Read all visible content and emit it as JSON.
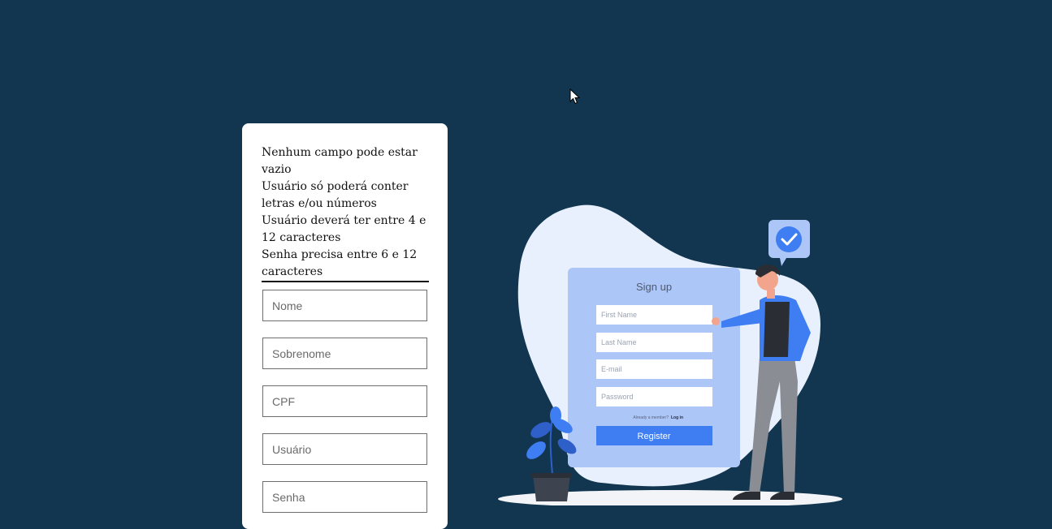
{
  "rules": [
    "Nenhum campo pode estar vazio",
    "Usuário só poderá conter letras e/ou números",
    "Usuário deverá ter entre 4 e 12 caracteres",
    "Senha precisa entre 6 e 12 caracteres"
  ],
  "form": {
    "fields": [
      {
        "placeholder": "Nome",
        "value": ""
      },
      {
        "placeholder": "Sobrenome",
        "value": ""
      },
      {
        "placeholder": "CPF",
        "value": ""
      },
      {
        "placeholder": "Usuário",
        "value": ""
      },
      {
        "placeholder": "Senha",
        "value": ""
      }
    ]
  },
  "illustration": {
    "title": "Sign up",
    "fields": [
      "First Name",
      "Last Name",
      "E-mail",
      "Password"
    ],
    "member_text": "Already a member?",
    "login_text": "Log in",
    "button": "Register"
  },
  "colors": {
    "background": "#12364f",
    "card": "#ffffff",
    "accent": "#3f7ef2",
    "blob": "#e9f0fd",
    "signup_panel": "#adc6f8"
  }
}
